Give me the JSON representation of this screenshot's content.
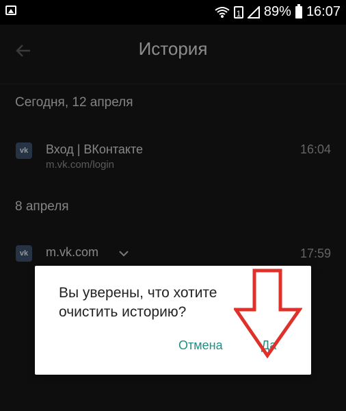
{
  "status_bar": {
    "sim_label": "1",
    "battery": "89%",
    "time": "16:07"
  },
  "toolbar": {
    "title": "История",
    "back_icon": "arrow-left"
  },
  "sections": [
    {
      "header": "Сегодня, 12 апреля",
      "items": [
        {
          "icon": "vk",
          "title": "Вход | ВКонтакте",
          "url": "m.vk.com/login",
          "time": "16:04"
        }
      ]
    },
    {
      "header": "8 апреля",
      "items": [
        {
          "icon": "vk",
          "title": "m.vk.com",
          "time": "17:59",
          "expand_icon": "chevron-down"
        }
      ]
    }
  ],
  "dialog": {
    "message": "Вы уверены, что хотите очистить историю?",
    "cancel_label": "Отмена",
    "confirm_label": "Да"
  },
  "colors": {
    "background": "#161616",
    "accent_button": "#1e8f85",
    "annotation_arrow": "#e0302a"
  }
}
